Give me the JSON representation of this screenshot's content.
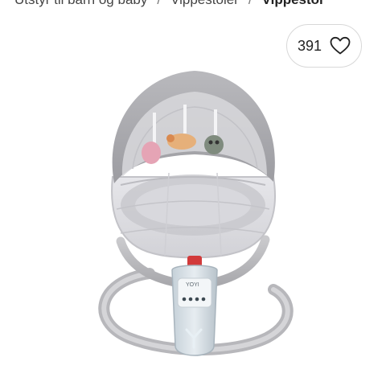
{
  "breadcrumb": {
    "items": [
      "Utstyr til barn og baby",
      "Vippestoler",
      "Vippestol"
    ],
    "separator": "/"
  },
  "favorite": {
    "count": "391",
    "icon": "heart-outline-icon"
  },
  "product": {
    "image_alt": "Vippestol",
    "panel_brand": "YOYI"
  }
}
